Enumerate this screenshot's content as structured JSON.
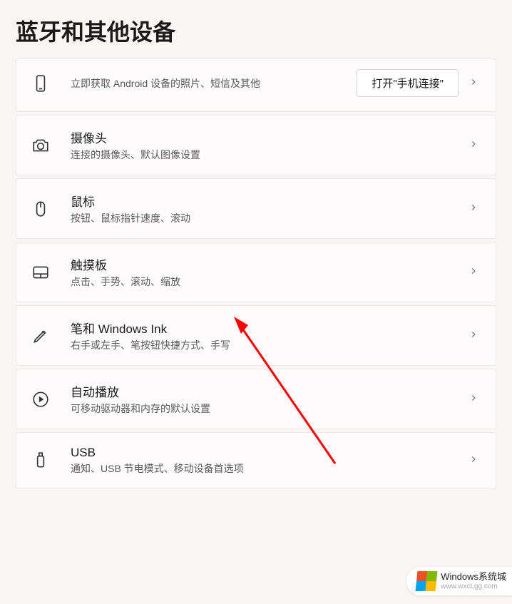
{
  "page_title": "蓝牙和其他设备",
  "items": [
    {
      "title": "",
      "subtitle": "立即获取 Android 设备的照片、短信及其他",
      "button": "打开\"手机连接\""
    },
    {
      "title": "摄像头",
      "subtitle": "连接的摄像头、默认图像设置"
    },
    {
      "title": "鼠标",
      "subtitle": "按钮、鼠标指针速度、滚动"
    },
    {
      "title": "触摸板",
      "subtitle": "点击、手势、滚动、缩放"
    },
    {
      "title": "笔和 Windows Ink",
      "subtitle": "右手或左手、笔按钮快捷方式、手写"
    },
    {
      "title": "自动播放",
      "subtitle": "可移动驱动器和内存的默认设置"
    },
    {
      "title": "USB",
      "subtitle": "通知、USB 节电模式、移动设备首选项"
    }
  ],
  "watermark": {
    "title": "Windows系统城",
    "sub": "www.wxcLgg.com"
  }
}
